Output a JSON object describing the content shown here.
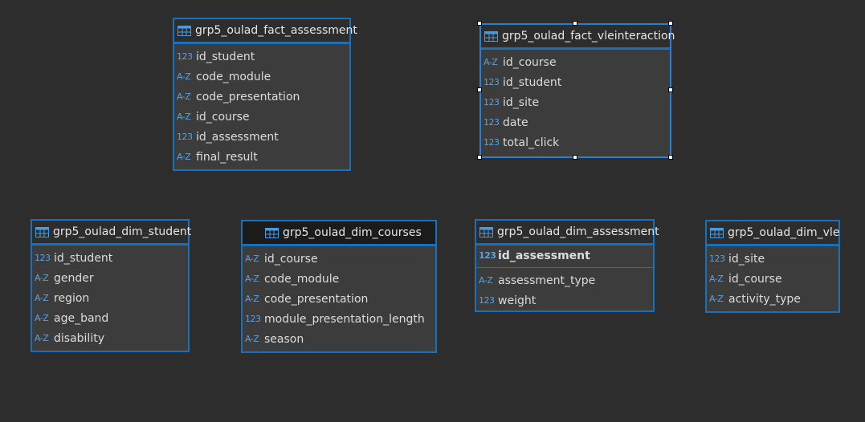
{
  "entities": [
    {
      "title": "grp5_oulad_fact_assessment",
      "attributes": [
        {
          "type": "123",
          "name": "id_student"
        },
        {
          "type": "A-Z",
          "name": "code_module"
        },
        {
          "type": "A-Z",
          "name": "code_presentation"
        },
        {
          "type": "A-Z",
          "name": "id_course"
        },
        {
          "type": "123",
          "name": "id_assessment"
        },
        {
          "type": "A-Z",
          "name": "final_result"
        }
      ]
    },
    {
      "title": "grp5_oulad_fact_vleinteraction",
      "attributes": [
        {
          "type": "A-Z",
          "name": "id_course"
        },
        {
          "type": "123",
          "name": "id_student"
        },
        {
          "type": "123",
          "name": "id_site"
        },
        {
          "type": "123",
          "name": "date"
        },
        {
          "type": "123",
          "name": "total_click"
        }
      ]
    },
    {
      "title": "grp5_oulad_dim_student",
      "attributes": [
        {
          "type": "123",
          "name": "id_student"
        },
        {
          "type": "A-Z",
          "name": "gender"
        },
        {
          "type": "A-Z",
          "name": "region"
        },
        {
          "type": "A-Z",
          "name": "age_band"
        },
        {
          "type": "A-Z",
          "name": "disability"
        }
      ]
    },
    {
      "title": "grp5_oulad_dim_courses",
      "attributes": [
        {
          "type": "A-Z",
          "name": "id_course"
        },
        {
          "type": "A-Z",
          "name": "code_module"
        },
        {
          "type": "A-Z",
          "name": "code_presentation"
        },
        {
          "type": "123",
          "name": "module_presentation_length"
        },
        {
          "type": "A-Z",
          "name": "season"
        }
      ]
    },
    {
      "title": "grp5_oulad_dim_assessment",
      "primary_key": {
        "type": "123",
        "name": "id_assessment"
      },
      "attributes": [
        {
          "type": "A-Z",
          "name": "assessment_type"
        },
        {
          "type": "123",
          "name": "weight"
        }
      ]
    },
    {
      "title": "grp5_oulad_dim_vle",
      "attributes": [
        {
          "type": "123",
          "name": "id_site"
        },
        {
          "type": "A-Z",
          "name": "id_course"
        },
        {
          "type": "A-Z",
          "name": "activity_type"
        }
      ]
    }
  ],
  "icons": {
    "entity": "table-icon",
    "numeric_type": "123",
    "text_type": "A-Z"
  },
  "colors": {
    "canvas": "#2d2d2d",
    "entity_border": "#1d6fb8",
    "entity_body": "#3c3c3c",
    "type_icon": "#5aa1e0"
  }
}
